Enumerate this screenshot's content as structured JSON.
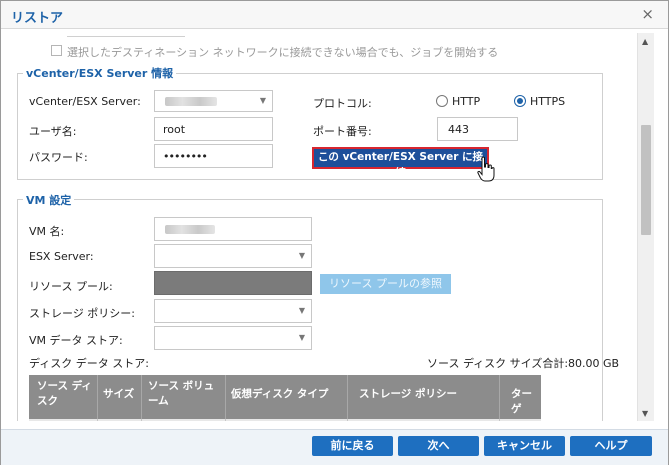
{
  "dialog": {
    "title": "リストア",
    "close_glyph": "×"
  },
  "options": {
    "start_job_checkbox": "選択したデスティネーション ネットワークに接続できない場合でも、ジョブを開始する"
  },
  "vcenter": {
    "group_title": "vCenter/ESX Server 情報",
    "server_label": "vCenter/ESX Server:",
    "user_label": "ユーザ名:",
    "user_value": "root",
    "password_label": "パスワード:",
    "password_value": "••••••••",
    "protocol_label": "プロトコル:",
    "http_label": "HTTP",
    "https_label": "HTTPS",
    "protocol_selected": "HTTPS",
    "port_label": "ポート番号:",
    "port_value": "443",
    "connect_button": "この vCenter/ESX Server に接続"
  },
  "vm": {
    "group_title": "VM 設定",
    "vm_name_label": "VM 名:",
    "esx_server_label": "ESX Server:",
    "resource_pool_label": "リソース プール:",
    "resource_pool_button": "リソース プールの参照",
    "storage_policy_label": "ストレージ ポリシー:",
    "datastore_label": "VM データ ストア:",
    "disk_datastore_label": "ディスク データ ストア:",
    "source_disk_total": "ソース ディスク サイズ合計:80.00 GB",
    "table": {
      "columns": [
        "ソース ディスク",
        "サイズ",
        "ソース ボリューム",
        "仮想ディスク タイプ",
        "ストレージ ポリシー",
        "ターゲ"
      ],
      "rows": [
        [
          "",
          "",
          "\\\\?",
          "",
          "",
          ""
        ]
      ]
    }
  },
  "footer": {
    "back": "前に戻る",
    "next": "次へ",
    "cancel": "キャンセル",
    "help": "ヘルプ"
  },
  "colors": {
    "accent": "#1d62a8",
    "primary_button": "#1e6fc0",
    "highlight_border": "#d8262f"
  }
}
